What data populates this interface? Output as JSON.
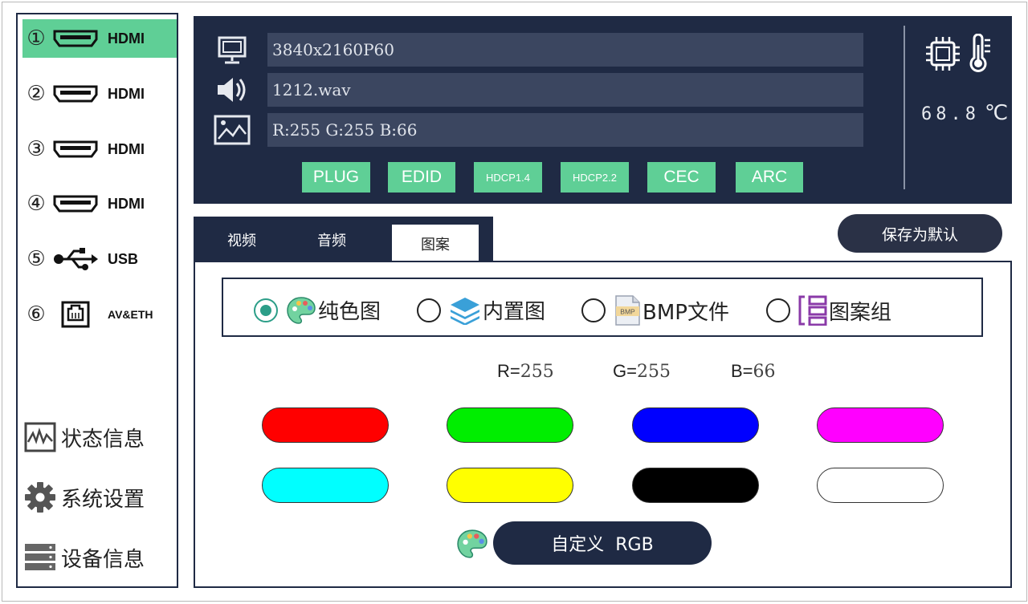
{
  "sidebar": {
    "inputs": [
      {
        "num": "①",
        "icon": "hdmi-port-icon",
        "label": "HDMI",
        "active": true
      },
      {
        "num": "②",
        "icon": "hdmi-port-icon",
        "label": "HDMI",
        "active": false
      },
      {
        "num": "③",
        "icon": "hdmi-port-icon",
        "label": "HDMI",
        "active": false
      },
      {
        "num": "④",
        "icon": "hdmi-port-icon",
        "label": "HDMI",
        "active": false
      },
      {
        "num": "⑤",
        "icon": "usb-icon",
        "label": "USB",
        "active": false
      },
      {
        "num": "⑥",
        "icon": "ethernet-port-icon",
        "label": "AV&ETH",
        "active": false
      }
    ],
    "bottom": [
      {
        "icon": "waveform-icon",
        "label": "状态信息"
      },
      {
        "icon": "gear-icon",
        "label": "系统设置"
      },
      {
        "icon": "server-stack-icon",
        "label": "设备信息"
      }
    ]
  },
  "info": {
    "video": "3840x2160P60",
    "audio": "1212.wav",
    "pattern": "R:255 G:255 B:66",
    "chips": [
      "PLUG",
      "EDID",
      "HDCP1.4",
      "HDCP2.2",
      "CEC",
      "ARC"
    ],
    "temperature": "68.8",
    "temp_unit": "℃"
  },
  "tabs": [
    "视频",
    "音频",
    "图案"
  ],
  "active_tab": "图案",
  "save_label": "保存为默认",
  "pattern_options": [
    {
      "label": "纯色图",
      "icon": "palette-icon",
      "selected": true
    },
    {
      "label": "内置图",
      "icon": "layers-icon",
      "selected": false
    },
    {
      "label": "BMP文件",
      "icon": "bmp-file-icon",
      "selected": false
    },
    {
      "label": "图案组",
      "icon": "pattern-group-icon",
      "selected": false
    }
  ],
  "rgb": {
    "r_label": "R=",
    "r": "255",
    "g_label": "G=",
    "g": "255",
    "b_label": "B=",
    "b": "66"
  },
  "colors": {
    "accent": "#5fcf96",
    "navy": "#1f2a44",
    "swatches": [
      "#ff0000",
      "#00ee00",
      "#0000ff",
      "#ff00ff",
      "#00ffff",
      "#ffff00",
      "#000000",
      "#ffffff"
    ]
  },
  "custom_rgb_label": "自定义  RGB"
}
